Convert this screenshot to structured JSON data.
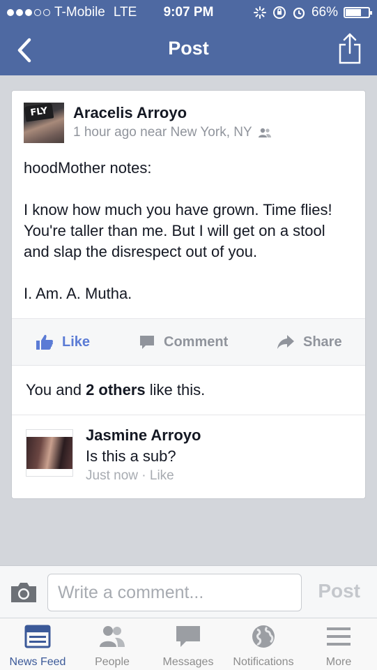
{
  "status_bar": {
    "carrier": "T-Mobile",
    "network": "LTE",
    "time": "9:07 PM",
    "battery": "66%",
    "battery_level": 0.66
  },
  "nav": {
    "title": "Post",
    "back_icon": "chevron-left-icon",
    "share_icon": "share-icon"
  },
  "post": {
    "author": "Aracelis Arroyo",
    "meta": "1 hour ago near New York, NY",
    "audience_icon": "friends-icon",
    "paragraphs": [
      "hoodMother notes:",
      "I know how much you have grown.  Time flies!  You're taller than me.  But I will get on a stool and slap the disrespect out of you.",
      "I. Am. A. Mutha."
    ],
    "avatar_caption": "FLY",
    "actions": {
      "like": "Like",
      "comment": "Comment",
      "share": "Share"
    },
    "likes": {
      "prefix": "You and ",
      "bold": "2 others",
      "suffix": " like this."
    }
  },
  "comment": {
    "author": "Jasmine Arroyo",
    "text": "Is this a sub?",
    "time": "Just now",
    "separator": " · ",
    "like": "Like"
  },
  "composer": {
    "placeholder": "Write a comment...",
    "post": "Post"
  },
  "tabs": [
    {
      "label": "News Feed",
      "icon": "news-feed-icon",
      "active": true
    },
    {
      "label": "People",
      "icon": "people-icon"
    },
    {
      "label": "Messages",
      "icon": "messages-icon"
    },
    {
      "label": "Notifications",
      "icon": "globe-icon"
    },
    {
      "label": "More",
      "icon": "menu-icon"
    }
  ],
  "colors": {
    "brand": "#4e69a2",
    "like_blue": "#5b7bd5",
    "background": "#d3d6db"
  }
}
